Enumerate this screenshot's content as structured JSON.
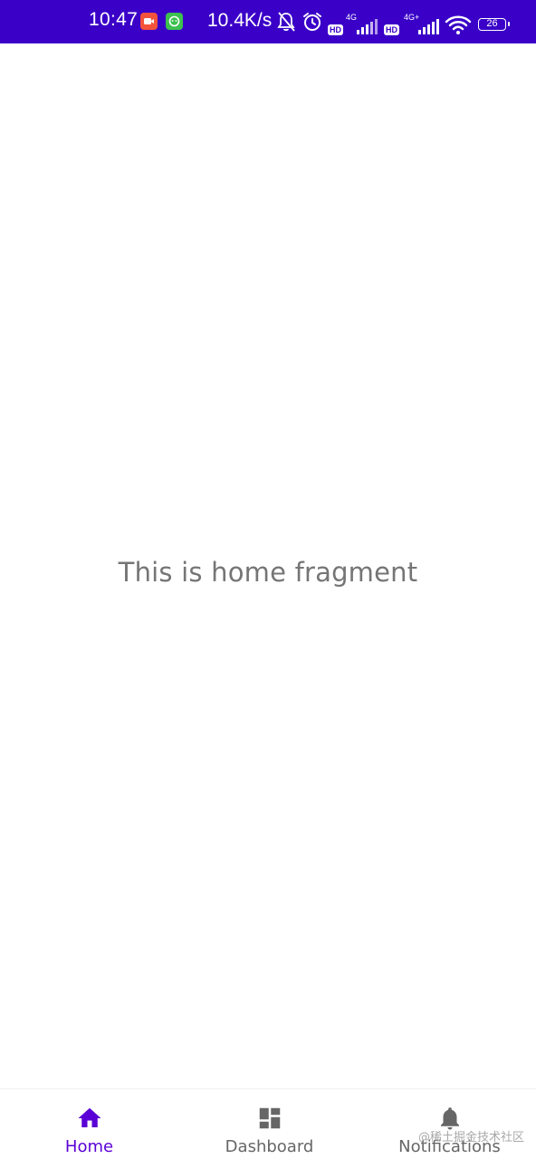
{
  "status_bar": {
    "time": "10:47",
    "net_speed": "10.4K/s",
    "hd_label_1": "HD",
    "net_type_1": "4G",
    "hd_label_2": "HD",
    "net_type_2": "4G+",
    "battery": "26",
    "background_color": "#3a00c8",
    "icons": [
      "video-app-icon",
      "chat-app-icon",
      "mute-icon",
      "alarm-icon",
      "signal-icon",
      "wifi-icon",
      "battery-icon"
    ]
  },
  "main": {
    "text": "This is home fragment",
    "text_color": "#757575"
  },
  "bottom_nav": {
    "items": [
      {
        "label": "Home",
        "icon": "home-icon",
        "selected": true
      },
      {
        "label": "Dashboard",
        "icon": "dashboard-icon",
        "selected": false
      },
      {
        "label": "Notifications",
        "icon": "bell-icon",
        "selected": false
      }
    ],
    "active_color": "#5a00d6",
    "inactive_color": "#666666"
  },
  "watermark": {
    "text": "@稀土掘金技术社区"
  }
}
